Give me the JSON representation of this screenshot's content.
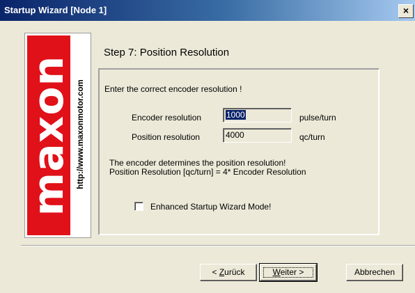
{
  "window": {
    "title": "Startup Wizard  [Node 1]",
    "close_glyph": "×"
  },
  "logo": {
    "brand": "maxon",
    "url": "http://www.maxonmotor.com",
    "brand_color": "#e01119"
  },
  "step": {
    "title": "Step 7: Position Resolution",
    "instruction": "Enter the correct encoder resolution !"
  },
  "fields": {
    "encoder": {
      "label": "Encoder resolution",
      "value": "1000",
      "unit": "pulse/turn"
    },
    "position": {
      "label": "Position resolution",
      "value": "4000",
      "unit": "qc/turn"
    }
  },
  "info": {
    "line1": "The encoder determines the position resolution!",
    "line2": "Position Resolution [qc/turn] = 4* Encoder Resolution"
  },
  "option": {
    "label": "Enhanced Startup Wizard Mode!",
    "checked": false
  },
  "buttons": {
    "back": {
      "prefix": "< ",
      "mnemonic": "Z",
      "rest": "urück"
    },
    "next": {
      "mnemonic": "W",
      "rest": "eiter >"
    },
    "cancel": {
      "label": "Abbrechen"
    }
  }
}
